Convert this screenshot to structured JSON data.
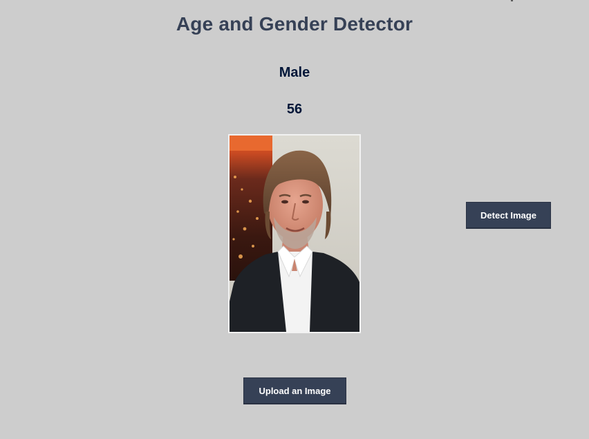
{
  "app": {
    "title": "Age and Gender Detector"
  },
  "result": {
    "gender": "Male",
    "age": "56"
  },
  "buttons": {
    "detect_label": "Detect Image",
    "upload_label": "Upload an Image"
  },
  "colors": {
    "background": "#cdcdcd",
    "title": "#364156",
    "result_text": "#011638",
    "button_bg": "#364156",
    "button_text": "#ffffff"
  }
}
